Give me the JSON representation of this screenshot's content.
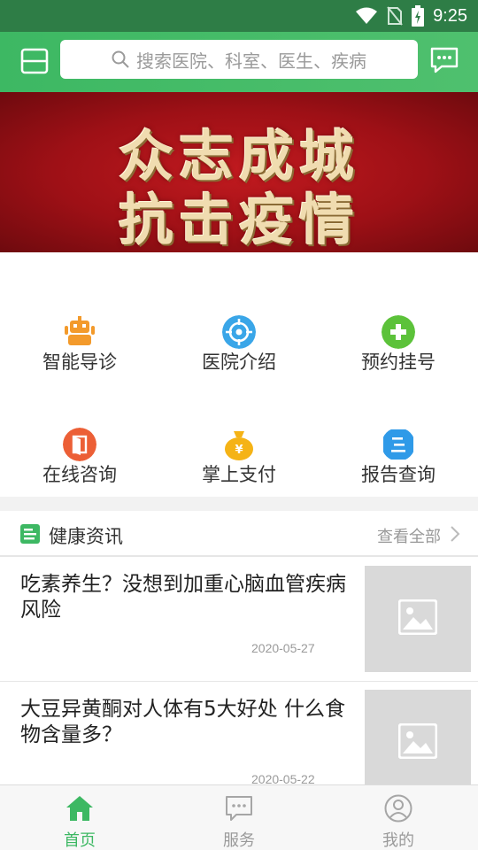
{
  "status_bar": {
    "time": "9:25"
  },
  "header": {
    "search_placeholder": "搜索医院、科室、医生、疾病"
  },
  "banner": {
    "line1": "众志成城",
    "line2": "抗击疫情"
  },
  "grid": [
    {
      "label": "智能导诊",
      "icon": "robot-icon",
      "color": "#f39a2b"
    },
    {
      "label": "医院介绍",
      "icon": "target-icon",
      "color": "#3aa6e8"
    },
    {
      "label": "预约挂号",
      "icon": "plus-icon",
      "color": "#5cc23a"
    },
    {
      "label": "在线咨询",
      "icon": "door-icon",
      "color": "#ec5f36"
    },
    {
      "label": "掌上支付",
      "icon": "money-bag-icon",
      "color": "#f5b316"
    },
    {
      "label": "报告查询",
      "icon": "document-icon",
      "color": "#2f9ae8"
    }
  ],
  "news": {
    "title": "健康资讯",
    "see_all": "查看全部",
    "items": [
      {
        "headline": "吃素养生？没想到加重心脑血管疾病风险",
        "date": "2020-05-27"
      },
      {
        "headline": "大豆异黄酮对人体有5大好处 什么食物含量多？",
        "date": "2020-05-22"
      }
    ]
  },
  "nav": [
    {
      "label": "首页",
      "icon": "home-icon",
      "active": true
    },
    {
      "label": "服务",
      "icon": "chat-icon",
      "active": false
    },
    {
      "label": "我的",
      "icon": "user-icon",
      "active": false
    }
  ],
  "colors": {
    "primary": "#3db863",
    "status_bar": "#2e7d46",
    "banner_red": "#b3151b"
  }
}
